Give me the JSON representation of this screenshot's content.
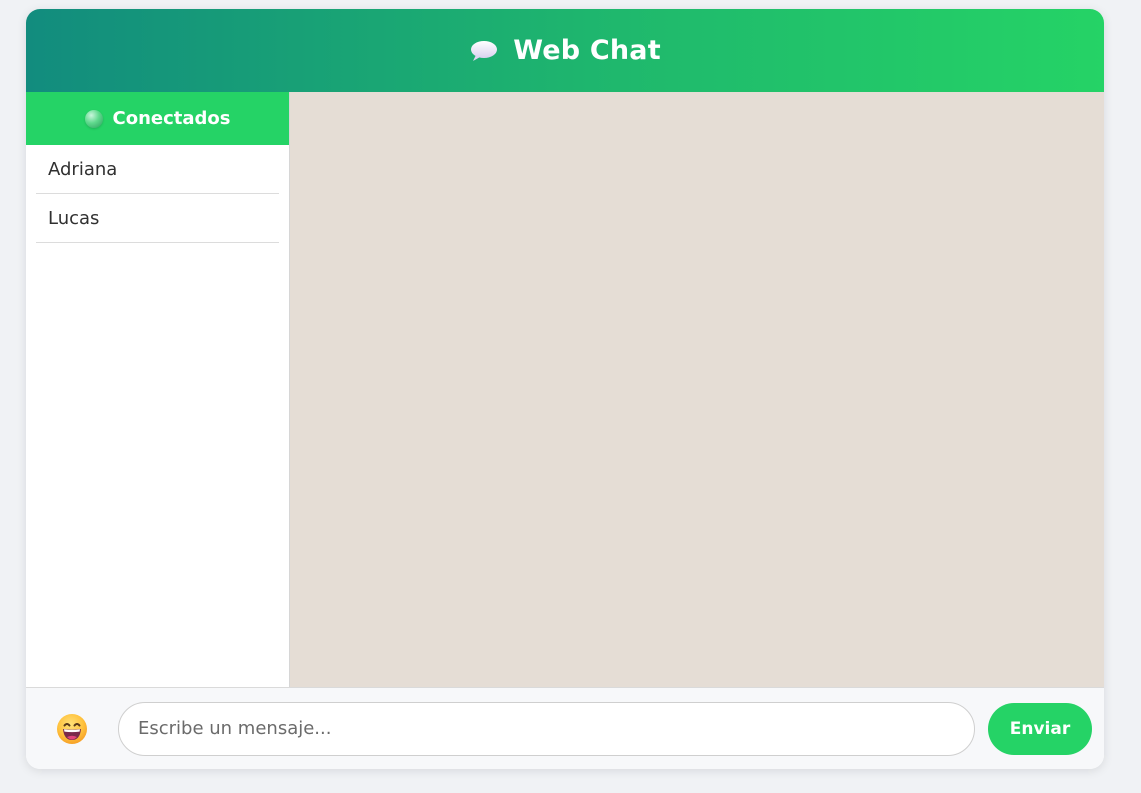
{
  "header": {
    "title": "Web Chat",
    "icon": "speech-bubble-icon"
  },
  "sidebar": {
    "title": "Conectados",
    "status_icon": "online-dot-icon",
    "users": [
      {
        "name": "Adriana"
      },
      {
        "name": "Lucas"
      }
    ]
  },
  "composer": {
    "emoji_icon": "grinning-face-icon",
    "placeholder": "Escribe un mensaje...",
    "value": "",
    "send_label": "Enviar"
  },
  "colors": {
    "accent": "#25d366",
    "header_start": "#128c7e",
    "chat_background": "#e5ddd5",
    "page_background": "#f0f2f5"
  }
}
